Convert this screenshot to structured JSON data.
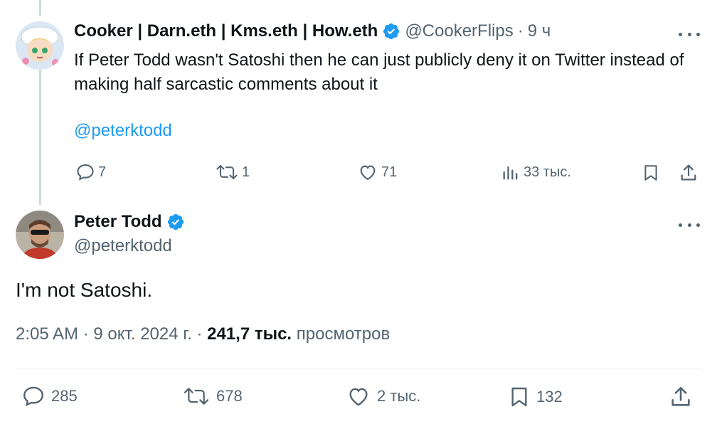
{
  "reply": {
    "name": "Cooker | Darn.eth | Kms.eth | How.eth",
    "handle": "@CookerFlips",
    "dot": "·",
    "time": "9 ч",
    "text": "If Peter Todd wasn't Satoshi then he can just publicly deny it on Twitter instead of making half sarcastic comments about it",
    "mention": "@peterktodd",
    "actions": {
      "replies": "7",
      "reposts": "1",
      "likes": "71",
      "views": "33 тыс."
    }
  },
  "main": {
    "name": "Peter Todd",
    "handle": "@peterktodd",
    "text": "I'm not Satoshi.",
    "meta": {
      "time": "2:05 AM",
      "sep1": "·",
      "date": "9 окт. 2024 г.",
      "sep2": "·",
      "views_count": "241,7 тыс.",
      "views_label": "просмотров"
    },
    "actions": {
      "replies": "285",
      "reposts": "678",
      "likes": "2 тыс.",
      "bookmarks": "132"
    }
  },
  "colors": {
    "accent": "#1d9bf0",
    "muted": "#536471",
    "text": "#0f1419"
  }
}
